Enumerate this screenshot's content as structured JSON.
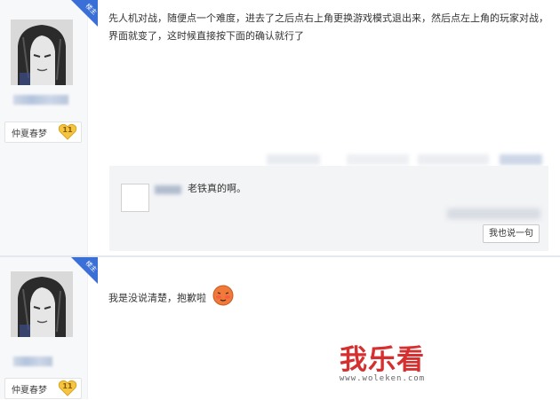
{
  "posts": [
    {
      "badge": "楼主",
      "level_name": "仲夏春梦",
      "level": "11",
      "content": "先人机对战，随便点一个难度，进去了之后点右上角更换游戏模式退出来，然后点左上角的玩家对战，界面就变了，这时候直接按下面的确认就行了",
      "reply": {
        "text": "老铁真的啊。",
        "button_label": "我也说一句"
      }
    },
    {
      "badge": "楼主",
      "level_name": "仲夏春梦",
      "level": "11",
      "content": "我是没说清楚，抱歉啦"
    }
  ],
  "watermark": {
    "logo": "我乐看",
    "url": "www.woleken.com"
  },
  "colors": {
    "badge_blue": "#3a6fd8",
    "level_gold": "#f5c542",
    "watermark_red": "#d62f2f"
  }
}
